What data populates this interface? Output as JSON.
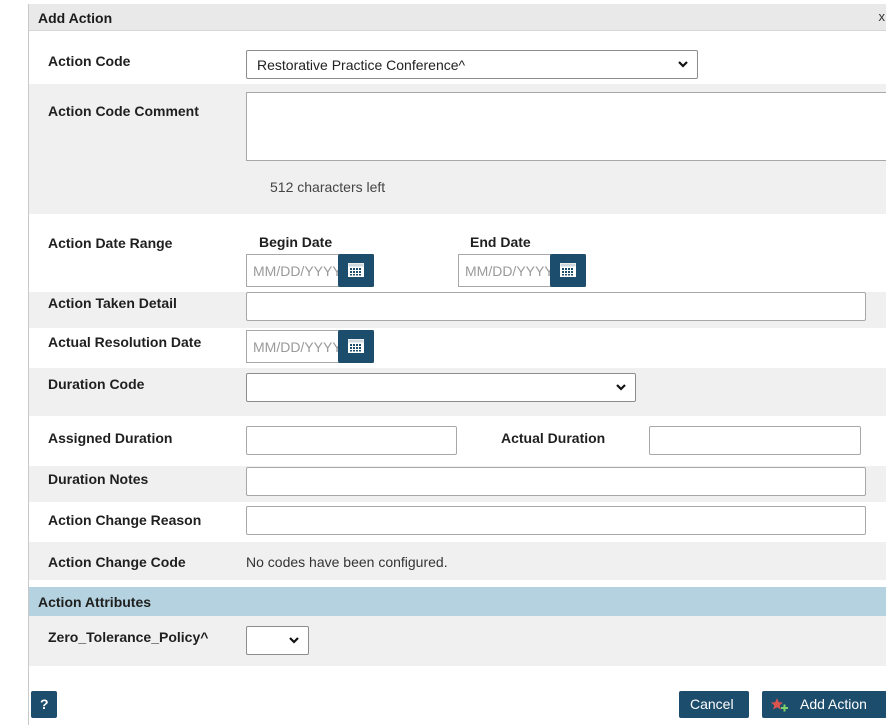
{
  "dialog": {
    "title": "Add Action",
    "close_glyph": "x"
  },
  "form": {
    "action_code": {
      "label": "Action Code",
      "value": "Restorative Practice Conference^"
    },
    "action_code_comment": {
      "label": "Action Code Comment",
      "value": "",
      "chars_left": "512 characters left"
    },
    "action_date_range": {
      "label": "Action Date Range",
      "begin_label": "Begin Date",
      "end_label": "End Date",
      "begin_placeholder": "MM/DD/YYYY",
      "end_placeholder": "MM/DD/YYYY"
    },
    "action_taken_detail": {
      "label": "Action Taken Detail",
      "value": ""
    },
    "actual_resolution_date": {
      "label": "Actual Resolution Date",
      "placeholder": "MM/DD/YYYY"
    },
    "duration_code": {
      "label": "Duration Code",
      "value": ""
    },
    "assigned_duration": {
      "label": "Assigned Duration",
      "value": ""
    },
    "actual_duration": {
      "label": "Actual Duration",
      "value": ""
    },
    "duration_notes": {
      "label": "Duration Notes",
      "value": ""
    },
    "action_change_reason": {
      "label": "Action Change Reason",
      "value": ""
    },
    "action_change_code": {
      "label": "Action Change Code",
      "value": "No codes have been configured."
    }
  },
  "attributes": {
    "header": "Action Attributes",
    "zero_tolerance": {
      "label": "Zero_Tolerance_Policy^",
      "value": ""
    }
  },
  "footer": {
    "help_label": "?",
    "cancel_label": "Cancel",
    "add_label": "Add Action"
  },
  "colors": {
    "primary_button": "#1d4d6c",
    "section_header": "#b4d2df",
    "title_bar": "#e9e9e9",
    "shaded_row": "#f0f0f0"
  },
  "icons": {
    "calendar": "calendar-icon",
    "chevron": "chevron-down-icon",
    "add": "add-action-icon"
  }
}
